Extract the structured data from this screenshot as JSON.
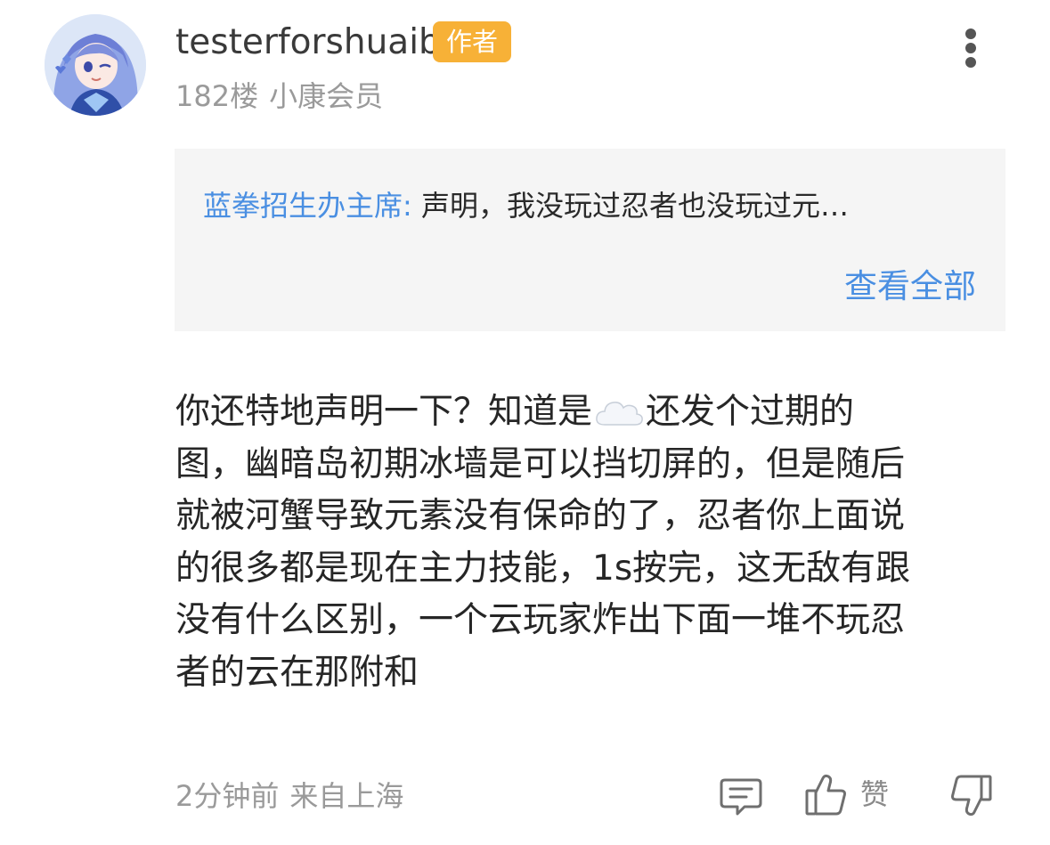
{
  "header": {
    "username": "testerforshuaib",
    "author_badge": "作者",
    "floor": "182楼",
    "member_level": "小康会员"
  },
  "quote": {
    "author": "蓝拳招生办主席:",
    "text": "声明，我没玩过忍者也没玩过元…",
    "view_all": "查看全部"
  },
  "content": {
    "lines": [
      [
        "你还特地声明一下？知道是",
        "还发个过期的"
      ],
      "图，幽暗岛初期冰墙是可以挡切屏的，但是随后",
      "就被河蟹导致元素没有保命的了，忍者你上面说",
      "的很多都是现在主力技能，1s按完，这无敌有跟",
      "没有什么区别，一个云玩家炸出下面一堆不玩忍",
      "者的云在那附和"
    ],
    "emoji": "cloud"
  },
  "footer": {
    "time": "2分钟前",
    "location": "来自上海",
    "like_label": "赞"
  },
  "icons": {
    "more": "more-vertical-icon",
    "reply": "comment-icon",
    "like": "thumbs-up-icon",
    "dislike": "thumbs-down-icon"
  },
  "colors": {
    "accent_blue": "#4a8fe2",
    "badge_orange": "#f7b137",
    "muted_gray": "#9a9a9a",
    "quote_background": "#f5f5f5"
  }
}
